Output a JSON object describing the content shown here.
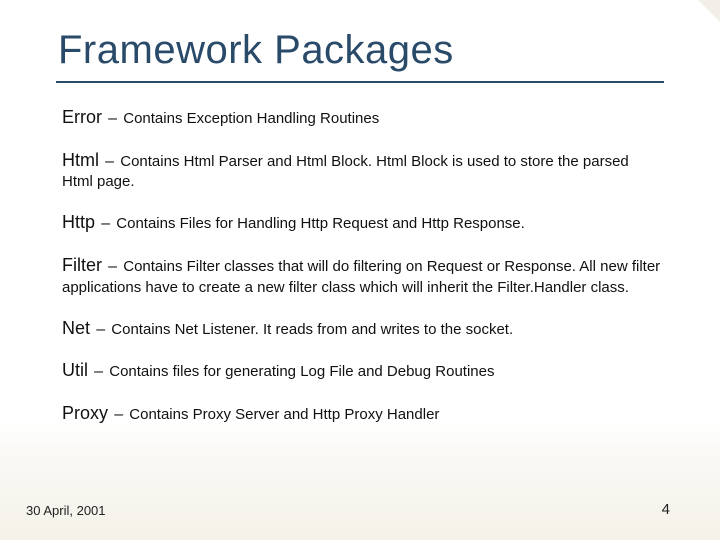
{
  "title": "Framework Packages",
  "entries": [
    {
      "name": "Error",
      "sep": "–",
      "desc": "Contains Exception Handling Routines"
    },
    {
      "name": "Html",
      "sep": "–",
      "desc": "Contains Html Parser and Html Block. Html Block is used to store the parsed Html page."
    },
    {
      "name": "Http",
      "sep": "–",
      "desc": "Contains Files for Handling Http Request and Http Response."
    },
    {
      "name": "Filter",
      "sep": "–",
      "desc": "Contains Filter classes that will do filtering on Request or Response. All new filter applications have to create a new filter class which will inherit the Filter.Handler class."
    },
    {
      "name": "Net",
      "sep": "–",
      "desc": "Contains Net Listener. It reads from and writes to the socket."
    },
    {
      "name": "Util",
      "sep": "–",
      "desc": "Contains files for generating Log File and Debug Routines"
    },
    {
      "name": "Proxy",
      "sep": "–",
      "desc": "Contains Proxy Server and Http Proxy Handler"
    }
  ],
  "footer": {
    "date": "30 April, 2001",
    "page": "4"
  }
}
